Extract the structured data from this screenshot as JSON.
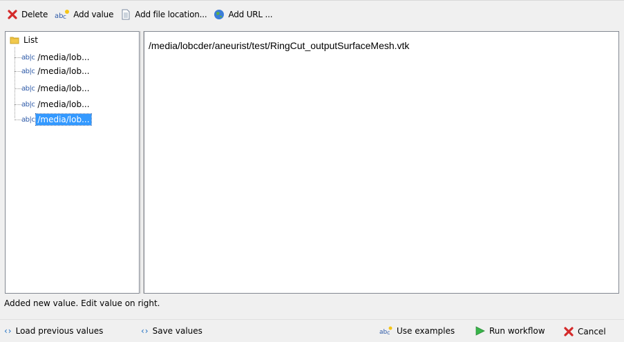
{
  "toolbar": {
    "delete_label": "Delete",
    "add_value_label": "Add value",
    "add_file_label": "Add file location...",
    "add_url_label": "Add URL ..."
  },
  "tree": {
    "root_label": "List",
    "items": [
      {
        "label": "/media/lob..."
      },
      {
        "label": "/media/lob..."
      },
      {
        "label": "/media/lob..."
      },
      {
        "label": "/media/lob..."
      },
      {
        "label": "/media/lob...",
        "selected": true
      }
    ]
  },
  "editor": {
    "value": "/media/lobcder/aneurist/test/RingCut_outputSurfaceMesh.vtk"
  },
  "status": {
    "message": "Added new value.  Edit value on right."
  },
  "bottom": {
    "load_previous_label": "Load previous values",
    "save_values_label": "Save values",
    "use_examples_label": "Use examples",
    "run_workflow_label": "Run workflow",
    "cancel_label": "Cancel"
  },
  "colors": {
    "selection": "#3399ff",
    "delete_icon": "#d42a2a",
    "run_icon": "#39b54a",
    "arrows": "#1e6fc2"
  }
}
